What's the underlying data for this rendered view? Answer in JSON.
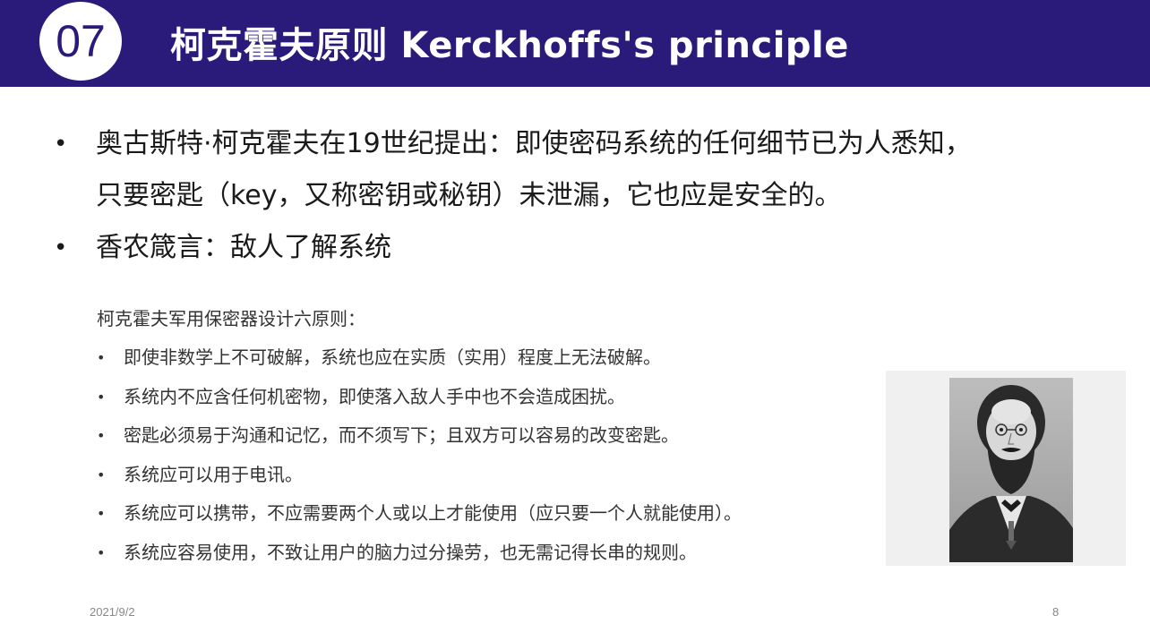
{
  "header": {
    "number": "07",
    "title": "柯克霍夫原则  Kerckhoffs's principle",
    "bg_color": "#2a1a7a"
  },
  "main_bullets": [
    "奥古斯特·柯克霍夫在19世纪提出：即使密码系统的任何细节已为人悉知，",
    "只要密匙（key，又称密钥或秘钥）未泄漏，它也应是安全的。",
    "香农箴言：敌人了解系统"
  ],
  "sub_section": {
    "title": "柯克霍夫军用保密器设计六原则：",
    "items": [
      "即使非数学上不可破解，系统也应在实质（实用）程度上无法破解。",
      "系统内不应含任何机密物，即使落入敌人手中也不会造成困扰。",
      "密匙必须易于沟通和记忆，而不须写下；且双方可以容易的改变密匙。",
      "系统应可以用于电讯。",
      "系统应可以携带，不应需要两个人或以上才能使用（应只要一个人就能使用）。",
      "系统应容易使用，不致让用户的脑力过分操劳，也无需记得长串的规则。"
    ]
  },
  "footer": {
    "date": "2021/9/2",
    "page": "8"
  }
}
